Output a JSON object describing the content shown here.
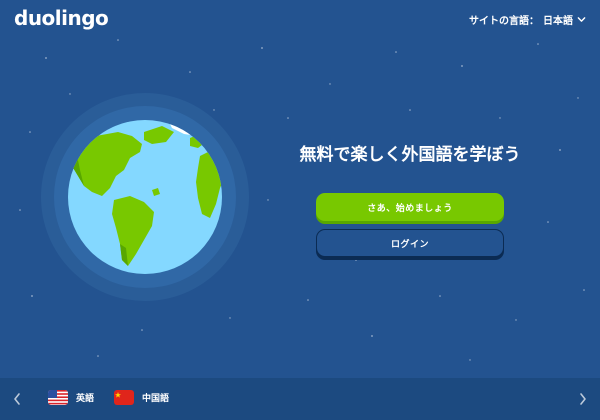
{
  "header": {
    "logo": "duolingo",
    "site_language_label": "サイトの言語：",
    "site_language_value": "日本語"
  },
  "hero": {
    "headline": "無料で楽しく外国語を学ぼう",
    "start_button": "さあ、始めましょう",
    "login_button": "ログイン"
  },
  "footer": {
    "languages": [
      {
        "label": "英語",
        "flag": "us-flag-icon"
      },
      {
        "label": "中国語",
        "flag": "cn-flag-icon"
      }
    ]
  },
  "colors": {
    "background": "#235390",
    "footer": "#1c4a80",
    "accent_green": "#78c800",
    "ocean": "#84d8ff",
    "land": "#78c800"
  }
}
